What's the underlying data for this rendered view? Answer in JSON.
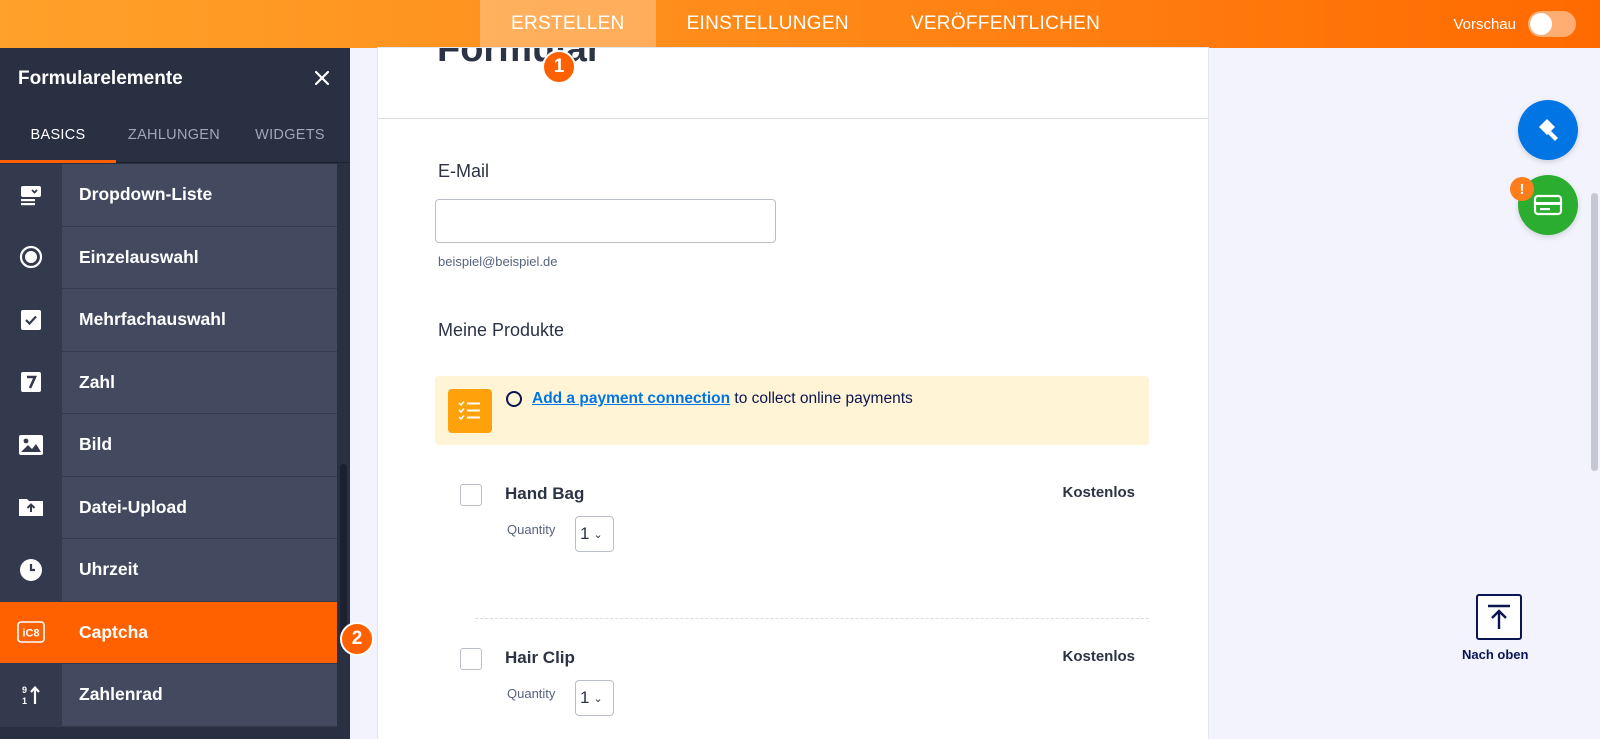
{
  "topbar": {
    "tabs": [
      {
        "label": "ERSTELLEN",
        "active": true
      },
      {
        "label": "EINSTELLUNGEN",
        "active": false
      },
      {
        "label": "VERÖFFENTLICHEN",
        "active": false
      }
    ],
    "preview_label": "Vorschau",
    "preview_on": false
  },
  "sidebar": {
    "title": "Formularelemente",
    "tabs": [
      "BASICS",
      "ZAHLUNGEN",
      "WIDGETS"
    ],
    "active_tab": "BASICS",
    "items": [
      {
        "label": "Dropdown-Liste",
        "icon": "dropdown-icon"
      },
      {
        "label": "Einzelauswahl",
        "icon": "radio-icon"
      },
      {
        "label": "Mehrfachauswahl",
        "icon": "checkbox-icon"
      },
      {
        "label": "Zahl",
        "icon": "number-icon"
      },
      {
        "label": "Bild",
        "icon": "image-icon"
      },
      {
        "label": "Datei-Upload",
        "icon": "upload-icon"
      },
      {
        "label": "Uhrzeit",
        "icon": "clock-icon"
      },
      {
        "label": "Captcha",
        "icon": "captcha-icon",
        "active": true
      },
      {
        "label": "Zahlenrad",
        "icon": "spinner-icon"
      }
    ]
  },
  "badges": {
    "one": "1",
    "two": "2"
  },
  "form": {
    "title": "Formular",
    "email": {
      "label": "E-Mail",
      "value": "",
      "sublabel": "beispiel@beispiel.de"
    },
    "products_label": "Meine Produkte",
    "payment_notice": {
      "link": "Add a payment connection",
      "text": " to collect online payments"
    },
    "products": [
      {
        "name": "Hand Bag",
        "price": "Kostenlos",
        "quantity_label": "Quantity",
        "quantity": "1"
      },
      {
        "name": "Hair Clip",
        "price": "Kostenlos",
        "quantity_label": "Quantity",
        "quantity": "1"
      }
    ]
  },
  "right": {
    "back_to_top": "Nach oben",
    "warning": "!"
  },
  "colors": {
    "accent": "#ff6100",
    "blue": "#0075e3",
    "green": "#2bad2f",
    "sidebar": "#293042"
  }
}
